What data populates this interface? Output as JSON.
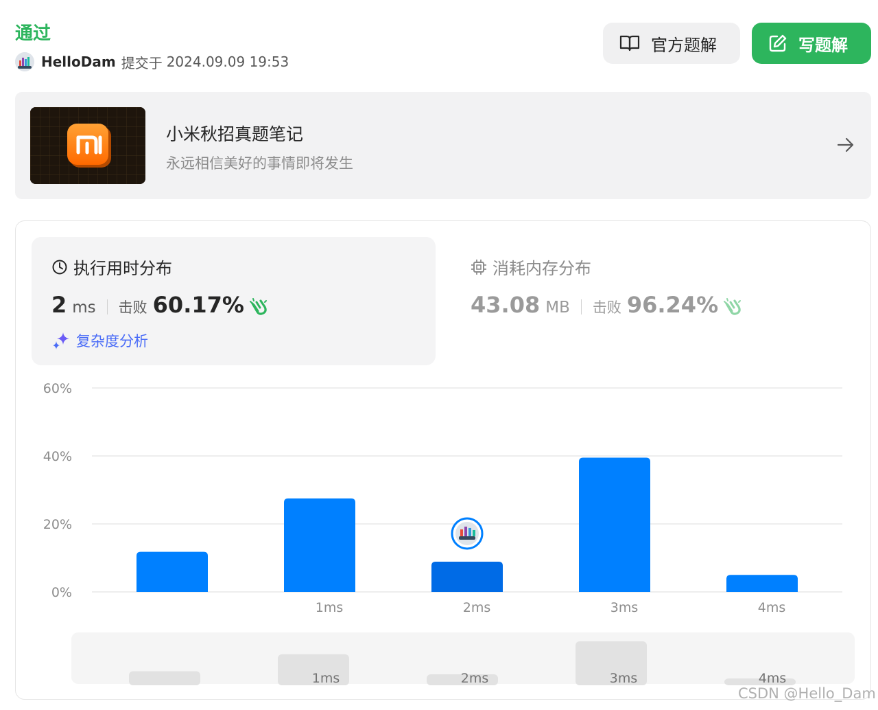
{
  "submission": {
    "status": "通过",
    "username": "HelloDam",
    "submitted_label": "提交于",
    "submitted_time": "2024.09.09 19:53"
  },
  "actions": {
    "solution_label": "官方题解",
    "write_label": "写题解"
  },
  "banner": {
    "title": "小米秋招真题笔记",
    "subtitle": "永远相信美好的事情即将发生",
    "logo_text": "mi"
  },
  "runtime": {
    "title": "执行用时分布",
    "value": "2",
    "unit": "ms",
    "beat_label": "击败",
    "beat_percent": "60.17%",
    "complexity_link": "复杂度分析"
  },
  "memory": {
    "title": "消耗内存分布",
    "value": "43.08",
    "unit": "MB",
    "beat_label": "击败",
    "beat_percent": "96.24%"
  },
  "colors": {
    "accent_green": "#2db55d",
    "bar_blue": "#0080ff",
    "bar_selected": "#006be6",
    "link_blue": "#4a6cf7"
  },
  "chart_data": {
    "type": "bar",
    "categories": [
      "",
      "1ms",
      "2ms",
      "3ms",
      "4ms"
    ],
    "values": [
      11.8,
      27.5,
      8.9,
      39.5,
      5.0
    ],
    "selected_index": 2,
    "yticks": [
      "0%",
      "20%",
      "40%",
      "60%"
    ],
    "ylim": [
      0,
      60
    ],
    "grid": true,
    "overview_labels": [
      "",
      "1ms",
      "2ms",
      "3ms",
      "4ms"
    ]
  },
  "watermark": "CSDN @Hello_Dam"
}
